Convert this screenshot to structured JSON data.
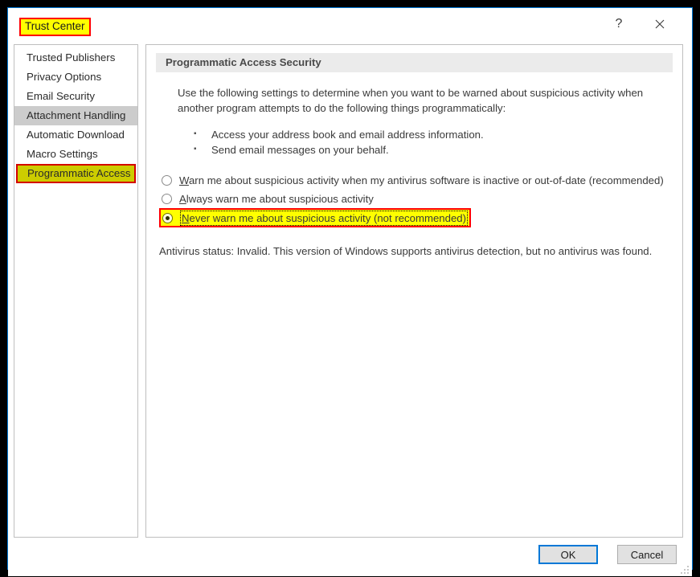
{
  "window": {
    "title": "Trust Center",
    "help_icon": "question-mark-icon",
    "close_icon": "close-x-icon",
    "accent_color": "#0078d7",
    "highlight_color": "#ffff00",
    "highlight_border_color": "#ff0000",
    "sidebar_highlight_color": "#cccc00"
  },
  "sidebar": {
    "items": [
      {
        "label": "Trusted Publishers",
        "selected": false,
        "annotated": false
      },
      {
        "label": "Privacy Options",
        "selected": false,
        "annotated": false
      },
      {
        "label": "Email Security",
        "selected": false,
        "annotated": false
      },
      {
        "label": "Attachment Handling",
        "selected": true,
        "annotated": false
      },
      {
        "label": "Automatic Download",
        "selected": false,
        "annotated": false
      },
      {
        "label": "Macro Settings",
        "selected": false,
        "annotated": false
      },
      {
        "label": "Programmatic Access",
        "selected": false,
        "annotated": true
      }
    ]
  },
  "main": {
    "section_header": "Programmatic Access Security",
    "intro": "Use the following settings to determine when you want to be warned about suspicious activity when another program attempts to do the following things programmatically:",
    "bullets": [
      "Access your address book and email address information.",
      "Send email messages on your behalf."
    ],
    "radios": [
      {
        "accel": "W",
        "rest": "arn me about suspicious activity when my antivirus software is inactive or out-of-date (recommended)",
        "checked": false,
        "annotated": false
      },
      {
        "accel": "A",
        "rest": "lways warn me about suspicious activity",
        "checked": false,
        "annotated": false
      },
      {
        "accel": "N",
        "rest": "ever warn me about suspicious activity (not recommended)",
        "checked": true,
        "annotated": true
      }
    ],
    "antivirus_status": "Antivirus status: Invalid. This version of Windows supports antivirus detection, but no antivirus was found."
  },
  "footer": {
    "ok_label": "OK",
    "cancel_label": "Cancel",
    "resize_grip_icon": "resize-grip-icon"
  }
}
